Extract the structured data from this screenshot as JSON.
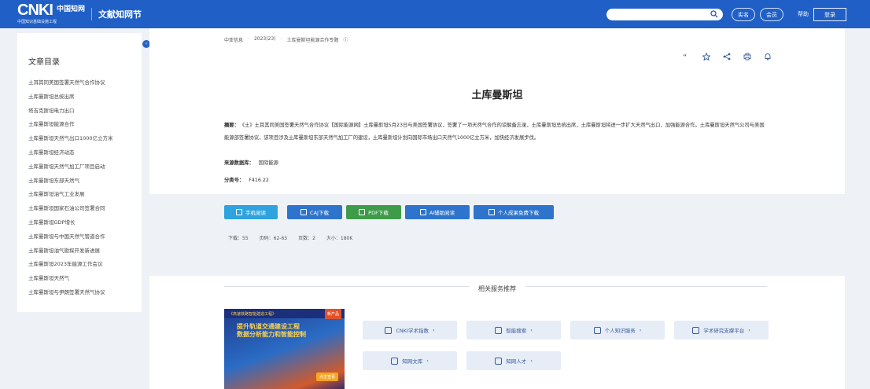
{
  "header": {
    "logo_big": "CNKI",
    "logo_cn": "中国知网",
    "logo_sub": "中国知识基础设施工程",
    "section_title": "文献知网节",
    "search_placeholder": "",
    "pill1": "实名",
    "pill2": "会员",
    "link": "帮助",
    "login": "登录"
  },
  "sidebar": {
    "heading": "文章目录",
    "items": [
      "土耳其同美国签署天然气合作协议",
      "土库曼斯坦总统出席",
      "塔吉克斯坦电力出口",
      "土库曼斯坦能源合作",
      "土库曼斯坦天然气出口1000亿立方米",
      "土库曼斯坦经济动态",
      "土库曼斯坦天然气加工厂项目启动",
      "土库曼斯坦东部天然气",
      "土库曼斯坦油气工业发展",
      "土库曼斯坦国家石油公司签署合同",
      "土库曼斯坦GDP增长",
      "土库曼斯坦与中国天然气管道合作",
      "土库曼斯坦油气勘探开发新进展",
      "土库曼斯坦2023年能源工作会议",
      "土库曼斯坦天然气",
      "土库曼斯坦与伊朗签署天然气协议"
    ]
  },
  "breadcrumb": [
    "中亚信息",
    "2023(23)",
    "土库曼斯坦能源合作专题"
  ],
  "tools": [
    "quote-icon",
    "star-icon",
    "share-icon",
    "print-icon",
    "bell-icon"
  ],
  "article": {
    "title": "土库曼斯坦",
    "abstract_label": "摘要：",
    "abstract": "《土》土耳其同美国签署天然气合作协议【国际能源网】土库曼斯坦5月23日与美国签署协议，签署了一项天然气合作的谅解备忘录，土库曼斯坦总统出席，土库曼斯坦将进一步扩大天然气出口，加强能源合作。土库曼斯坦天然气公司与美国能源部签署协议，该项目涉及土库曼斯坦东部天然气加工厂的建设，土库曼斯坦计划向国际市场出口天然气1000亿立方米，加快经济发展步伐。",
    "source_label": "来源数据库：",
    "source": "国际能源",
    "class_label": "分类号：",
    "class": "F416.22"
  },
  "downloads": [
    {
      "label": "手机阅读",
      "color": "#2fa3e0"
    },
    {
      "label": "CAJ下载",
      "color": "#2f74cc"
    },
    {
      "label": "PDF下载",
      "color": "#3e9b4a"
    },
    {
      "label": "AI辅助阅读",
      "color": "#2f74cc"
    },
    {
      "label": "个人成果免费下载",
      "color": "#2f74cc"
    }
  ],
  "stats": [
    "下载：55",
    "页码：62-63",
    "页数：2",
    "大小：180K"
  ],
  "related_title": "相关服务推荐",
  "promo": {
    "strip": "《高速铁路智能建造工程》",
    "badge": "新产品",
    "line1": "提升轨道交通建设工程",
    "line2": "数据分析能力和智能控制",
    "corner": "点击查看"
  },
  "services": [
    "CNKI学术指数",
    "智能搜索",
    "个人知识服务",
    "学术研究支撑平台",
    "知网文库",
    "知网人才"
  ]
}
